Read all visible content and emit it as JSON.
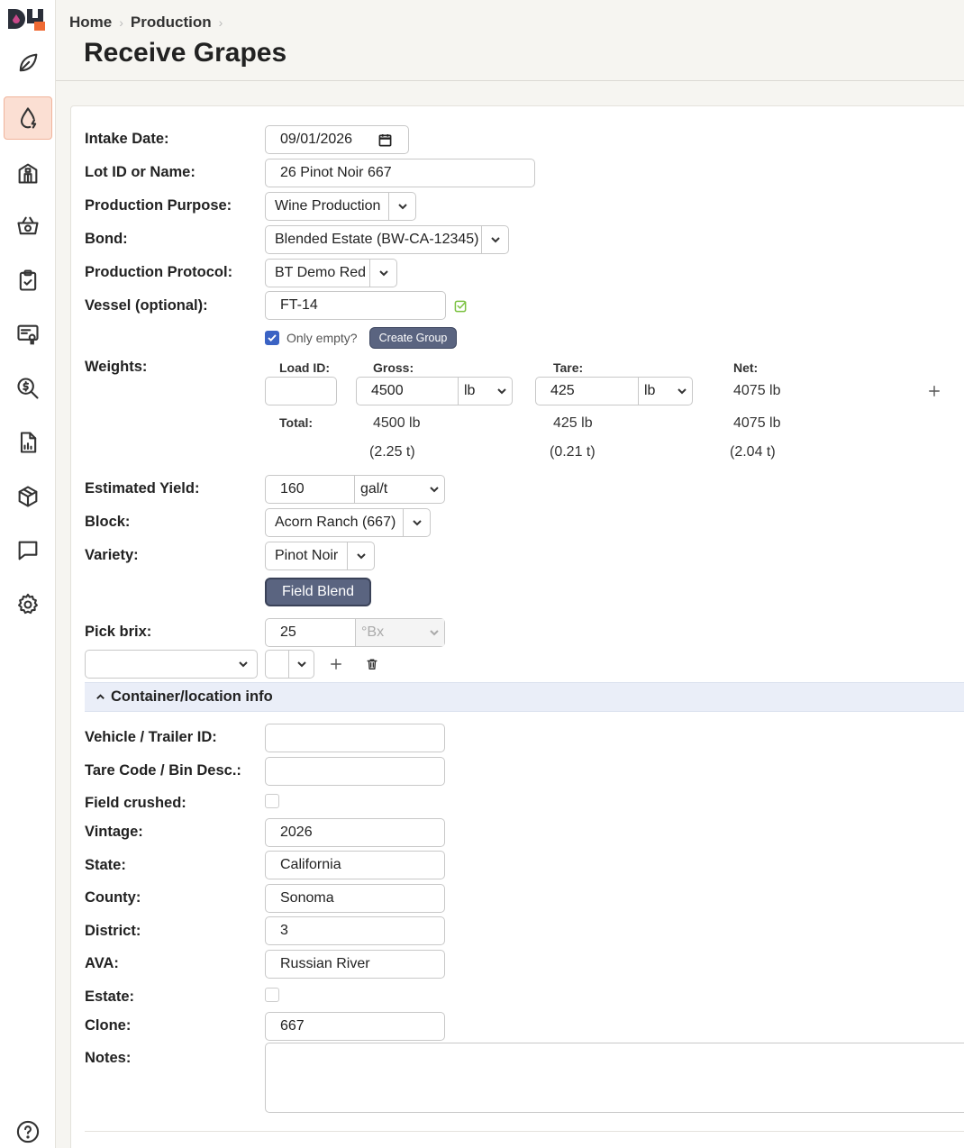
{
  "breadcrumb": {
    "home": "Home",
    "production": "Production"
  },
  "page": {
    "title": "Receive Grapes"
  },
  "nav": [
    "leaf-icon",
    "drop-icon",
    "building-icon",
    "basket-icon",
    "clipboard-check-icon",
    "certificate-icon",
    "search-dollar-icon",
    "report-icon",
    "box-icon",
    "chat-icon",
    "gear-icon",
    "help-icon"
  ],
  "form": {
    "intake_date_label": "Intake Date:",
    "intake_date_value": "09/01/2026",
    "lot_label": "Lot ID or Name:",
    "lot_value": "26 Pinot Noir 667",
    "purpose_label": "Production Purpose:",
    "purpose_value": "Wine Production",
    "bond_label": "Bond:",
    "bond_value": "Blended Estate (BW-CA-12345)",
    "protocol_label": "Production Protocol:",
    "protocol_value": "BT Demo Red",
    "vessel_label": "Vessel (optional):",
    "vessel_value": "FT-14",
    "only_empty_label": "Only empty?",
    "create_group_label": "Create Group",
    "weights_label": "Weights:",
    "load_id_header": "Load ID:",
    "gross_header": "Gross:",
    "tare_header": "Tare:",
    "net_header": "Net:",
    "gross_value": "4500",
    "gross_unit": "lb",
    "tare_value": "425",
    "tare_unit": "lb",
    "net_value": "4075 lb",
    "total_label": "Total:",
    "total_gross": "4500 lb",
    "total_tare": "425 lb",
    "total_net": "4075 lb",
    "total_gross_t": "(2.25 t)",
    "total_tare_t": "(0.21 t)",
    "total_net_t": "(2.04 t)",
    "yield_label": "Estimated Yield:",
    "yield_value": "160",
    "yield_unit": "gal/t",
    "block_label": "Block:",
    "block_value": "Acorn Ranch (667)",
    "variety_label": "Variety:",
    "variety_value": "Pinot Noir",
    "field_blend_label": "Field Blend",
    "pick_brix_label": "Pick brix:",
    "pick_brix_value": "25",
    "pick_brix_unit": "°Bx",
    "section_title": "Container/location info",
    "vehicle_label": "Vehicle / Trailer ID:",
    "tare_code_label": "Tare Code / Bin Desc.:",
    "field_crushed_label": "Field crushed:",
    "vintage_label": "Vintage:",
    "vintage_value": "2026",
    "state_label": "State:",
    "state_value": "California",
    "county_label": "County:",
    "county_value": "Sonoma",
    "district_label": "District:",
    "district_value": "3",
    "ava_label": "AVA:",
    "ava_value": "Russian River",
    "estate_label": "Estate:",
    "clone_label": "Clone:",
    "clone_value": "667",
    "notes_label": "Notes:"
  },
  "colors": {
    "accent": "#5a6480",
    "active_nav": "#fbdfd3",
    "checkbox": "#3b63c4"
  }
}
